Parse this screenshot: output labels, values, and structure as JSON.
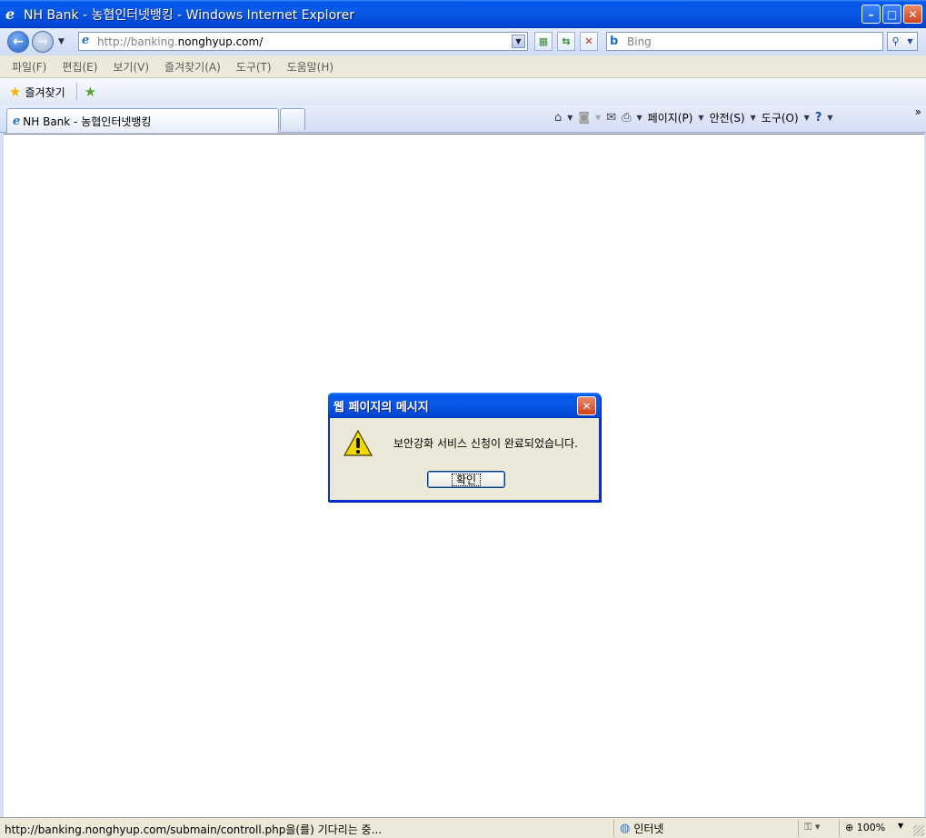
{
  "window": {
    "title": "NH Bank - 농협인터넷뱅킹 - Windows Internet Explorer"
  },
  "address": {
    "url_prefix": "http://banking.",
    "url_domain": "nonghyup.com/",
    "search_placeholder": "Bing"
  },
  "menu": {
    "items": [
      "파일(F)",
      "편집(E)",
      "보기(V)",
      "즐겨찾기(A)",
      "도구(T)",
      "도움말(H)"
    ]
  },
  "favorites": {
    "label": "즐겨찾기"
  },
  "tab": {
    "label": "NH Bank - 농협인터넷뱅킹"
  },
  "commands": {
    "page": "페이지(P)",
    "safety": "안전(S)",
    "tools": "도구(O)",
    "chevron": "»"
  },
  "dialog": {
    "title": "웹 페이지의 메시지",
    "message": "보안강화 서비스 신청이 완료되었습니다.",
    "ok_label": "확인"
  },
  "status": {
    "text": "http://banking.nonghyup.com/submain/controll.php을(를) 기다리는 중...",
    "zone": "인터넷",
    "zoom": "100%"
  },
  "colors": {
    "xp_blue": "#0058ee",
    "close_red": "#d2421a",
    "dialog_bg": "#ece9d8"
  }
}
